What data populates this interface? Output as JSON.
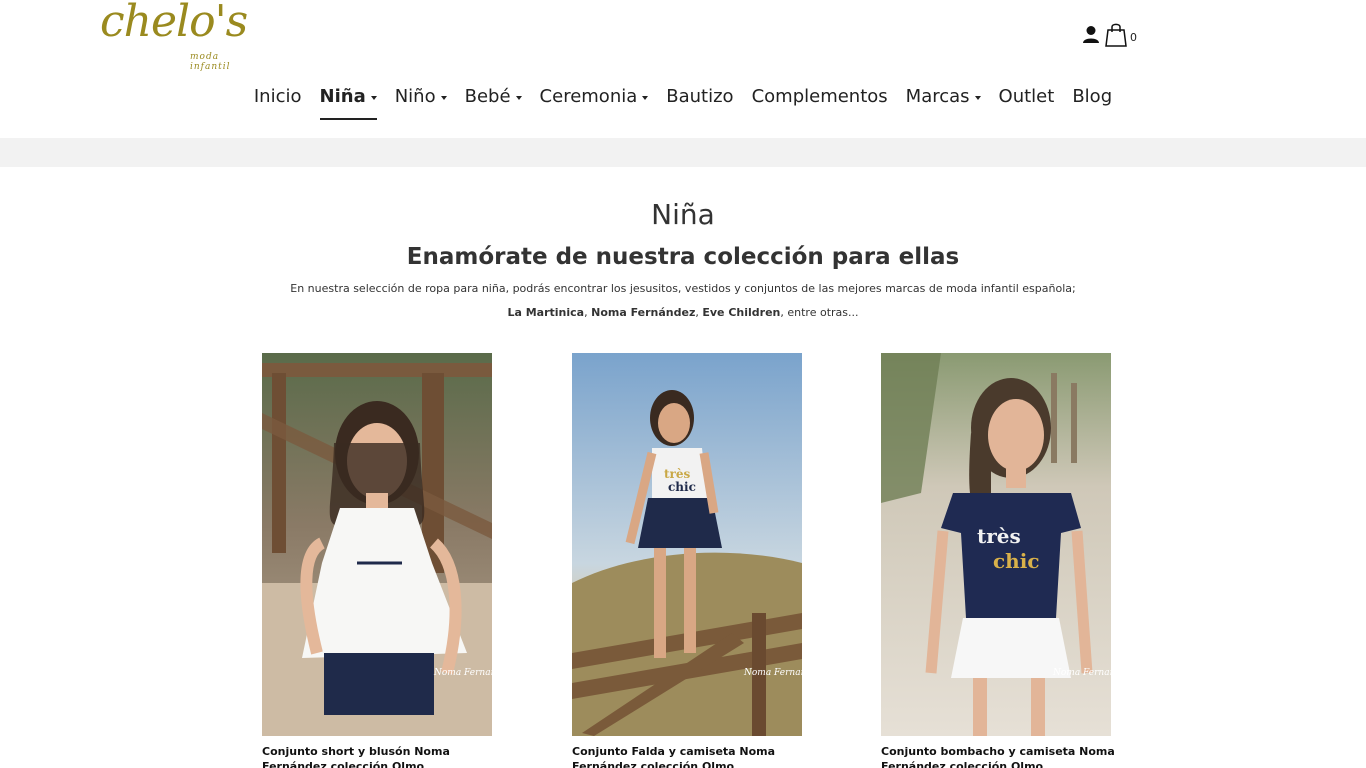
{
  "header": {
    "logo_text": "chelo's",
    "logo_subtitle": "moda infantil",
    "cart_count": "0"
  },
  "nav": {
    "items": [
      {
        "label": "Inicio"
      },
      {
        "label": "Niña"
      },
      {
        "label": "Niño"
      },
      {
        "label": "Bebé"
      },
      {
        "label": "Ceremonia"
      },
      {
        "label": "Bautizo"
      },
      {
        "label": "Complementos"
      },
      {
        "label": "Marcas"
      },
      {
        "label": "Outlet"
      },
      {
        "label": "Blog"
      }
    ]
  },
  "content": {
    "page_title": "Niña",
    "heading": "Enamórate de nuestra colección para ellas",
    "intro": "En nuestra selección de ropa para niña, podrás encontrar los jesusitos, vestidos y conjuntos de las mejores marcas de moda infantil española;",
    "brand1": "La Martinica",
    "brand2": "Noma Fernández",
    "brand3": "Eve Children",
    "brands_suffix": ", entre otras..."
  },
  "products": [
    {
      "title": "Conjunto short y blusón Noma Fernández colección Olmo"
    },
    {
      "title": "Conjunto Falda y camiseta Noma Fernández colección Olmo"
    },
    {
      "title": "Conjunto bombacho y camiseta Noma Fernández colección Olmo"
    }
  ],
  "colors": {
    "brand": "#9a8a1f",
    "band": "#f2f2f2",
    "text": "#222222"
  }
}
